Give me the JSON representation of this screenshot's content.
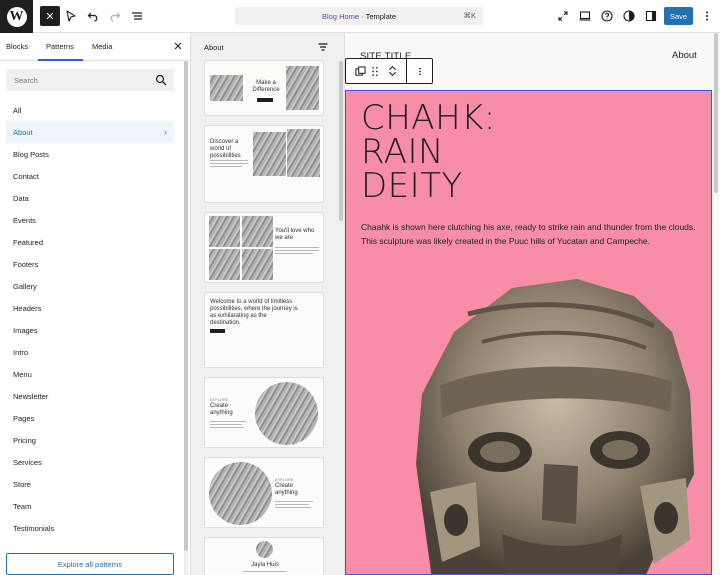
{
  "topbar": {
    "logo_icon": "wordpress-logo-icon",
    "logo_glyph": "W",
    "document_title": "Blog Home",
    "separator": "·",
    "document_type": "Template",
    "shortcut": "⌘K",
    "save_label": "Save",
    "accent_color": "#2271b1",
    "title_color": "#6b3fb3"
  },
  "sidebar": {
    "tabs": [
      "Blocks",
      "Patterns",
      "Media"
    ],
    "active_tab": "Patterns",
    "search_placeholder": "Search",
    "categories": [
      "All",
      "About",
      "Blog Posts",
      "Contact",
      "Data",
      "Events",
      "Featured",
      "Footers",
      "Gallery",
      "Headers",
      "Images",
      "Intro",
      "Menu",
      "Newsletter",
      "Pages",
      "Pricing",
      "Services",
      "Store",
      "Team",
      "Testimonials"
    ],
    "active_category": "About",
    "explore_label": "Explore all patterns"
  },
  "pattern_panel": {
    "title": "About",
    "previews": [
      {
        "heading": "Make a Difference"
      },
      {
        "heading": "Discover a world of possibilities"
      },
      {
        "heading": "You'll love who we are"
      },
      {
        "heading": "Welcome to a world of limitless possibilities, where the journey is as exhilarating as the destination."
      },
      {
        "kicker": "EXPLORE",
        "heading": "Create anything"
      },
      {
        "kicker": "EXPLORE",
        "heading": "Create anything"
      },
      {
        "heading": "Jayla Huis"
      }
    ]
  },
  "canvas": {
    "site_title": "SITE TITLE",
    "nav_about": "About",
    "hero": {
      "title_lines": [
        "CHAHK:",
        "RAIN",
        "DEITY"
      ],
      "description": "Chaahk is shown here clutching his axe, ready to strike rain and thunder from the clouds. This sculpture was likely created in the Puuc hills of Yucatan and Campeche.",
      "background": "#f78da7"
    }
  }
}
